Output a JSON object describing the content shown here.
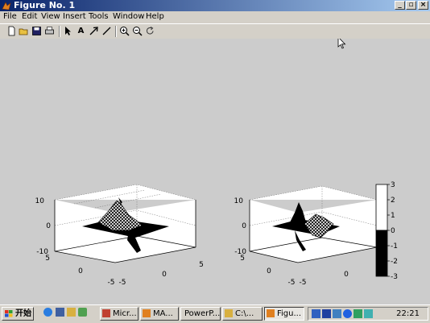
{
  "window": {
    "title": "Figure No. 1",
    "buttons": [
      "_",
      "▫",
      "×"
    ]
  },
  "menu": [
    "File",
    "Edit",
    "View",
    "Insert",
    "Tools",
    "Window",
    "Help"
  ],
  "toolbar": {
    "icons": [
      "new-figure-icon",
      "open-file-icon",
      "save-icon",
      "print-icon",
      "select-arrow-icon",
      "text-tool-icon",
      "arrow-tool-icon",
      "line-tool-icon",
      "zoom-in-icon",
      "zoom-out-icon",
      "rotate-3d-icon"
    ],
    "glyphs": [
      "",
      "",
      "",
      "",
      "➤",
      "A",
      "↗",
      "/",
      "⊕",
      "⊖",
      "↻"
    ]
  },
  "plots": {
    "left": {
      "z_ticks": [
        "10",
        "0",
        "-10"
      ],
      "y_ticks": [
        "5",
        "0",
        "-5"
      ],
      "x_ticks": [
        "-5",
        "0",
        "5"
      ]
    },
    "right": {
      "z_ticks": [
        "10",
        "0",
        "-10"
      ],
      "y_ticks": [
        "5",
        "0",
        "-5"
      ],
      "x_ticks": [
        "-5",
        "0",
        "5"
      ]
    },
    "colorbar": {
      "ticks": [
        "3",
        "2",
        "1",
        "0",
        "-1",
        "-2",
        "-3"
      ],
      "colors": [
        "#ffffff",
        "#000000"
      ]
    }
  },
  "taskbar": {
    "start_label": "开始",
    "tasks": [
      {
        "label": "Micr...",
        "icon": "word-icon"
      },
      {
        "label": "MA...",
        "icon": "matlab-icon"
      },
      {
        "label": "PowerP...",
        "icon": "powerpoint-icon"
      },
      {
        "label": "C:\\...",
        "icon": "folder-icon"
      },
      {
        "label": "Figu...",
        "icon": "figure-icon",
        "active": true
      }
    ],
    "clock": "22:21"
  }
}
